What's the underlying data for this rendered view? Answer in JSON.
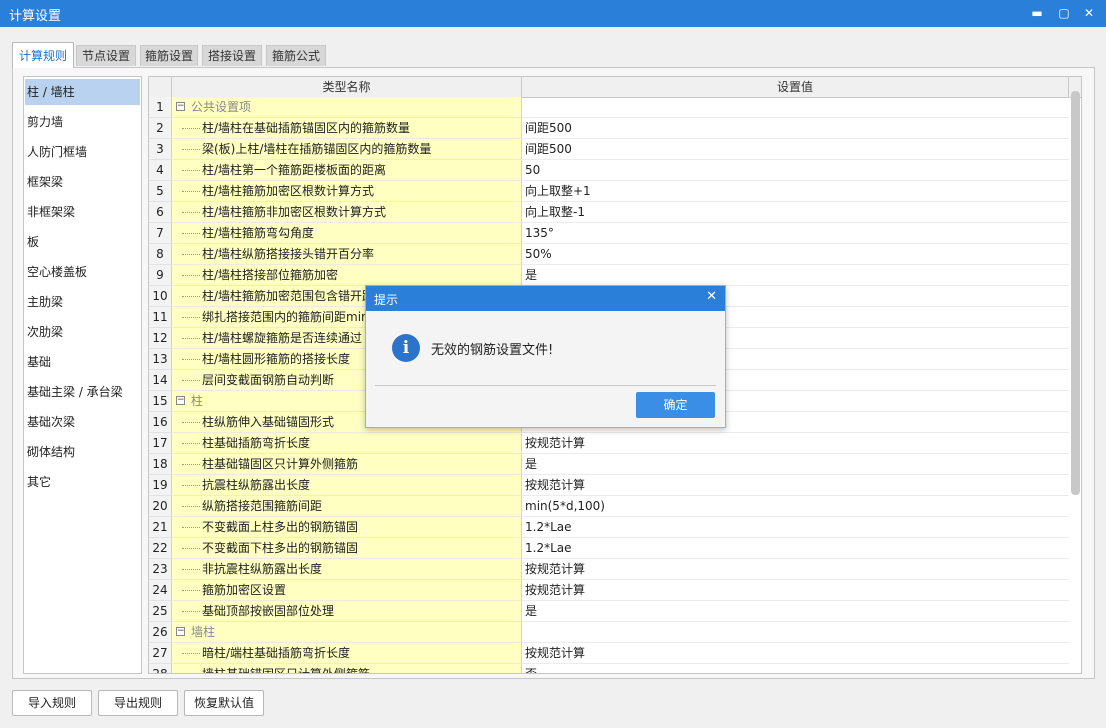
{
  "window": {
    "title": "计算设置"
  },
  "tabs": [
    {
      "label": "计算规则",
      "active": true
    },
    {
      "label": "节点设置"
    },
    {
      "label": "箍筋设置"
    },
    {
      "label": "搭接设置"
    },
    {
      "label": "箍筋公式"
    }
  ],
  "sidebar": {
    "items": [
      {
        "label": "柱 / 墙柱",
        "selected": true
      },
      {
        "label": "剪力墙"
      },
      {
        "label": "人防门框墙"
      },
      {
        "label": "框架梁"
      },
      {
        "label": "非框架梁"
      },
      {
        "label": "板"
      },
      {
        "label": "空心楼盖板"
      },
      {
        "label": "主肋梁"
      },
      {
        "label": "次肋梁"
      },
      {
        "label": "基础"
      },
      {
        "label": "基础主梁 / 承台梁"
      },
      {
        "label": "基础次梁"
      },
      {
        "label": "砌体结构"
      },
      {
        "label": "其它"
      }
    ]
  },
  "table": {
    "headers": {
      "name": "类型名称",
      "value": "设置值"
    },
    "rows": [
      {
        "num": "1",
        "name": "公共设置项",
        "value": "",
        "group": true
      },
      {
        "num": "2",
        "name": "柱/墙柱在基础插筋锚固区内的箍筋数量",
        "value": "间距500"
      },
      {
        "num": "3",
        "name": "梁(板)上柱/墙柱在插筋锚固区内的箍筋数量",
        "value": "间距500"
      },
      {
        "num": "4",
        "name": "柱/墙柱第一个箍筋距楼板面的距离",
        "value": "50"
      },
      {
        "num": "5",
        "name": "柱/墙柱箍筋加密区根数计算方式",
        "value": "向上取整+1"
      },
      {
        "num": "6",
        "name": "柱/墙柱箍筋非加密区根数计算方式",
        "value": "向上取整-1"
      },
      {
        "num": "7",
        "name": "柱/墙柱箍筋弯勾角度",
        "value": "135°"
      },
      {
        "num": "8",
        "name": "柱/墙柱纵筋搭接接头错开百分率",
        "value": "50%"
      },
      {
        "num": "9",
        "name": "柱/墙柱搭接部位箍筋加密",
        "value": "是"
      },
      {
        "num": "10",
        "name": "柱/墙柱箍筋加密范围包含错开距离",
        "value": ""
      },
      {
        "num": "11",
        "name": "绑扎搭接范围内的箍筋间距min",
        "value": ""
      },
      {
        "num": "12",
        "name": "柱/墙柱螺旋箍筋是否连续通过",
        "value": ""
      },
      {
        "num": "13",
        "name": "柱/墙柱圆形箍筋的搭接长度",
        "value": ""
      },
      {
        "num": "14",
        "name": "层间变截面钢筋自动判断",
        "value": ""
      },
      {
        "num": "15",
        "name": "柱",
        "value": "",
        "group": true
      },
      {
        "num": "16",
        "name": "柱纵筋伸入基础锚固形式",
        "value": ""
      },
      {
        "num": "17",
        "name": "柱基础插筋弯折长度",
        "value": "按规范计算"
      },
      {
        "num": "18",
        "name": "柱基础锚固区只计算外侧箍筋",
        "value": "是"
      },
      {
        "num": "19",
        "name": "抗震柱纵筋露出长度",
        "value": "按规范计算"
      },
      {
        "num": "20",
        "name": "纵筋搭接范围箍筋间距",
        "value": "min(5*d,100)"
      },
      {
        "num": "21",
        "name": "不变截面上柱多出的钢筋锚固",
        "value": "1.2*Lae"
      },
      {
        "num": "22",
        "name": "不变截面下柱多出的钢筋锚固",
        "value": "1.2*Lae"
      },
      {
        "num": "23",
        "name": "非抗震柱纵筋露出长度",
        "value": "按规范计算"
      },
      {
        "num": "24",
        "name": "箍筋加密区设置",
        "value": "按规范计算"
      },
      {
        "num": "25",
        "name": "基础顶部按嵌固部位处理",
        "value": "是"
      },
      {
        "num": "26",
        "name": "墙柱",
        "value": "",
        "group": true
      },
      {
        "num": "27",
        "name": "暗柱/端柱基础插筋弯折长度",
        "value": "按规范计算"
      },
      {
        "num": "28",
        "name": "墙柱基础锚固区只计算外侧箍筋",
        "value": "否"
      }
    ]
  },
  "buttons": {
    "import": "导入规则",
    "export": "导出规则",
    "restore": "恢复默认值"
  },
  "dialog": {
    "title": "提示",
    "message": "无效的钢筋设置文件!",
    "ok": "确定",
    "close_glyph": "✕",
    "icon_glyph": "i"
  },
  "icons": {
    "minimize": "▬",
    "maximize": "▢",
    "close": "✕",
    "collapse": "−"
  },
  "colors": {
    "title_bar": "#2a7fd8",
    "selected_item": "#b8d2f0",
    "name_cell": "#ffffc2",
    "ok_button": "#3a8ee6"
  }
}
